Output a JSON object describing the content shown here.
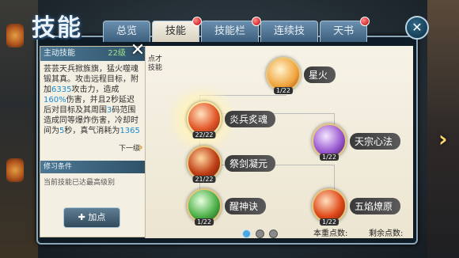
{
  "window": {
    "title": "技能"
  },
  "tabs": [
    {
      "label": "总览",
      "badge": false
    },
    {
      "label": "技能",
      "badge": true,
      "active": true
    },
    {
      "label": "技能栏",
      "badge": true
    },
    {
      "label": "连续技",
      "badge": false
    },
    {
      "label": "天书",
      "badge": true
    }
  ],
  "detail": {
    "header": "主动技能",
    "level": "22级",
    "description_parts": [
      "芸芸天兵掀旌旗，猛火噬魂锻其真。攻击远程目标，附加",
      "6335",
      "攻击力，造成",
      "160%",
      "伤害，并且2秒延迟后对目标及其周围",
      "3",
      "码范围造成同等爆炸伤害，冷却时间为",
      "5",
      "秒，真气消耗为",
      "1365"
    ],
    "next_level": "下一级",
    "cultivation_header": "修习条件",
    "cultivation_text": "当前技能已达最高级别",
    "add_point_label": "加点",
    "partial_text": "点才\n技能"
  },
  "skills": [
    {
      "name": "星火",
      "level": "1/22"
    },
    {
      "name": "炎兵炙魂",
      "level": "22/22"
    },
    {
      "name": "天宗心法",
      "level": "1/22"
    },
    {
      "name": "祭剑凝元",
      "level": "21/22"
    },
    {
      "name": "醒神诀",
      "level": "1/22"
    },
    {
      "name": "五焰燎原",
      "level": "1/22"
    }
  ],
  "pagination": {
    "pages": 3,
    "current": 1
  },
  "points": {
    "spent_label": "本重点数:",
    "spent_value": "",
    "remaining_label": "剩余点数:",
    "remaining_value": ""
  },
  "icons": {
    "close": "close-icon",
    "x": "x-icon",
    "arrow": "chevron-right-icon",
    "plus": "plus-icon"
  },
  "colors": {
    "tab_active": "#f4f0e6",
    "tab_inactive": "#3d5f7d",
    "highlight_number": "#1b8bcf",
    "badge": "#c00000"
  }
}
